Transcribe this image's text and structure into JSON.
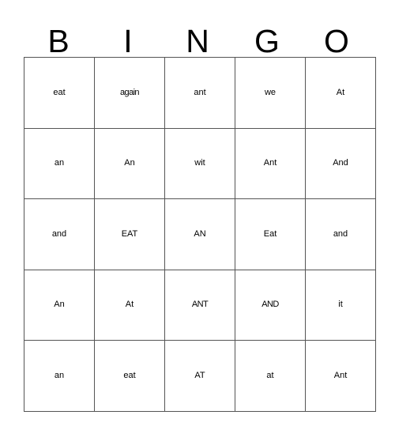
{
  "card": {
    "type": "bingo-card",
    "columns": 5,
    "rows": 5,
    "headers": [
      "B",
      "I",
      "N",
      "G",
      "O"
    ],
    "grid": [
      [
        "eat",
        "again",
        "ant",
        "we",
        "At"
      ],
      [
        "an",
        "An",
        "wit",
        "Ant",
        "And"
      ],
      [
        "and",
        "EAT",
        "AN",
        "Eat",
        "and"
      ],
      [
        "An",
        "At",
        "ANT",
        "AND",
        "it"
      ],
      [
        "an",
        "eat",
        "AT",
        "at",
        "Ant"
      ]
    ],
    "colors": {
      "background": "#ffffff",
      "text": "#000000",
      "grid_line": "#555555",
      "grid_outline": "#2b2b2b"
    }
  }
}
